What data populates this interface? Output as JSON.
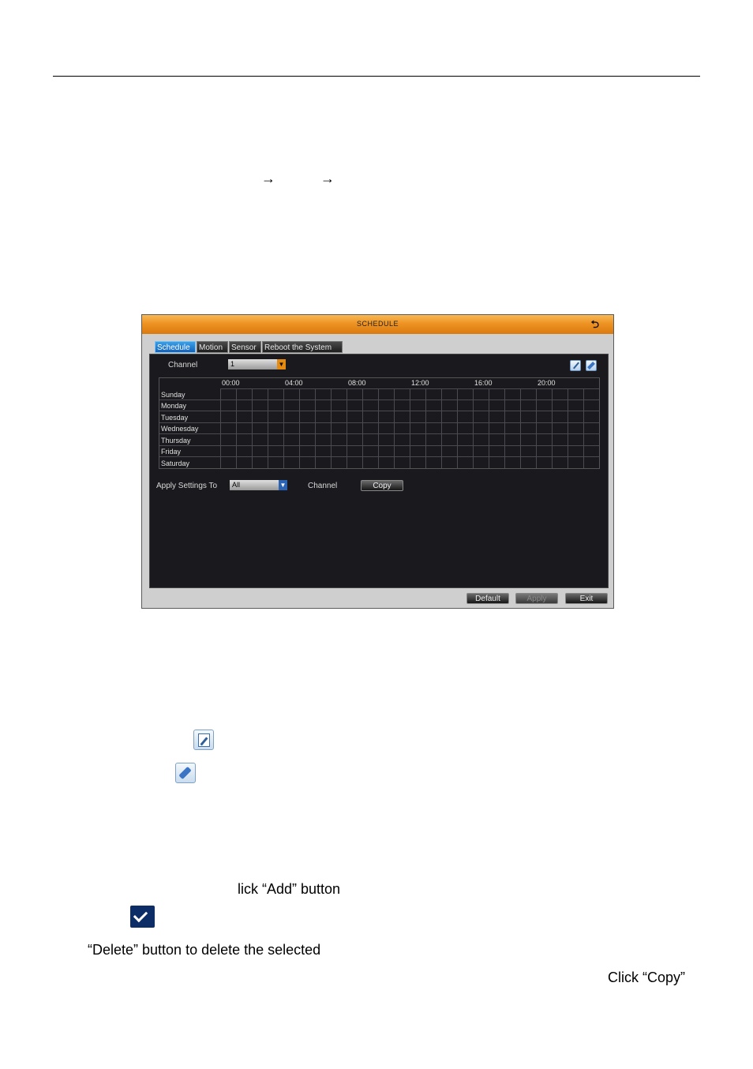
{
  "doc": {
    "arrows": [
      "→",
      "→"
    ],
    "add_line": "lick “Add” button",
    "delete_line": "“Delete” button to delete the selected",
    "copy_line": "Click “Copy”"
  },
  "window": {
    "title": "SCHEDULE",
    "back_icon": "return-icon",
    "tabs": [
      "Schedule",
      "Motion",
      "Sensor",
      "Reboot the System"
    ],
    "active_tab": "Schedule",
    "channel_label": "Channel",
    "channel_value": "1",
    "hours": [
      "00:00",
      "04:00",
      "08:00",
      "12:00",
      "16:00",
      "20:00"
    ],
    "days": [
      "Sunday",
      "Monday",
      "Tuesday",
      "Wednesday",
      "Thursday",
      "Friday",
      "Saturday"
    ],
    "apply_settings_label": "Apply Settings To",
    "apply_settings_value": "All",
    "copy_channel_label": "Channel",
    "copy_button": "Copy",
    "buttons": {
      "default": "Default",
      "apply": "Apply",
      "exit": "Exit"
    }
  },
  "colors": {
    "title_bar": "#ee9323",
    "active_tab": "#1462b8",
    "panel": "#1a1a1e"
  }
}
